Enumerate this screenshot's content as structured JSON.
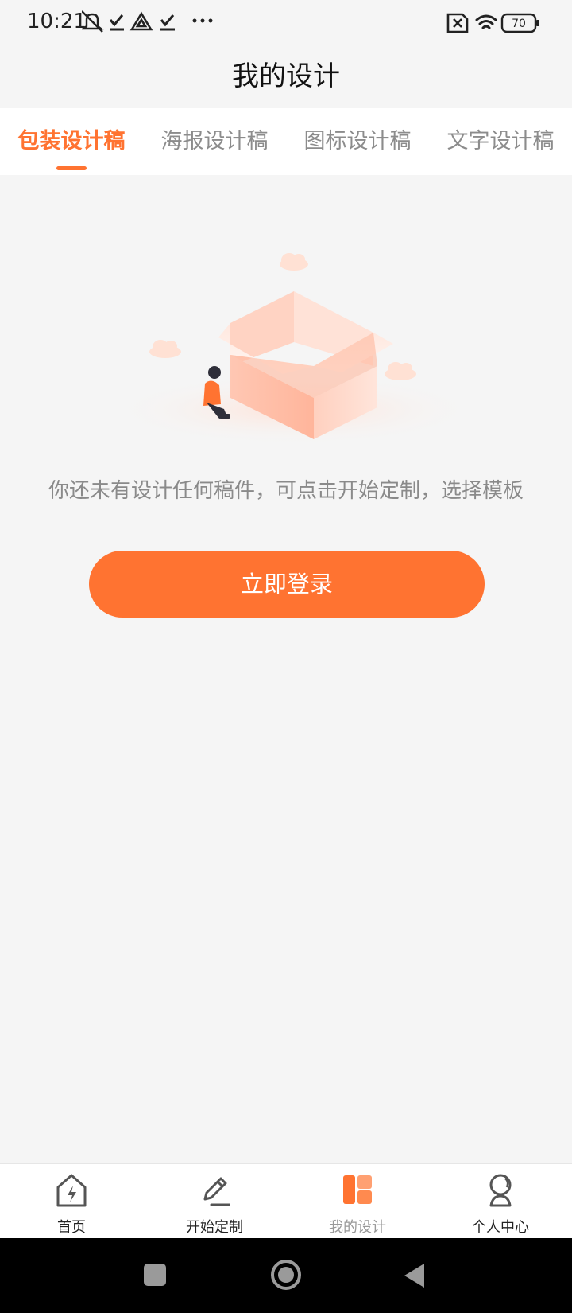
{
  "status_bar": {
    "time": "10:21",
    "left_icons": [
      "mute-icon",
      "check-icon",
      "app-icon",
      "check-icon",
      "more-icon"
    ],
    "battery": "70",
    "right_icons": [
      "sim-x-icon",
      "wifi-icon",
      "battery-icon"
    ]
  },
  "header": {
    "title": "我的设计"
  },
  "tabs": [
    {
      "label": "包装设计稿",
      "active": true
    },
    {
      "label": "海报设计稿",
      "active": false
    },
    {
      "label": "图标设计稿",
      "active": false
    },
    {
      "label": "文字设计稿",
      "active": false
    }
  ],
  "empty_state": {
    "illustration": "empty-box-illustration",
    "message": "你还未有设计任何稿件，可点击开始定制，选择模板"
  },
  "login_button": {
    "label": "立即登录"
  },
  "bottom_nav": [
    {
      "label": "首页",
      "icon": "home-icon",
      "active": false
    },
    {
      "label": "开始定制",
      "icon": "pencil-icon",
      "active": false
    },
    {
      "label": "我的设计",
      "icon": "design-grid-icon",
      "active": true
    },
    {
      "label": "个人中心",
      "icon": "user-icon",
      "active": false
    }
  ],
  "system_nav": [
    "square-button",
    "home-circle-button",
    "back-triangle-button"
  ],
  "colors": {
    "accent": "#ff7331",
    "background": "#f5f5f5",
    "tab_inactive": "#8c8c8c",
    "message": "#8a8a8a"
  }
}
